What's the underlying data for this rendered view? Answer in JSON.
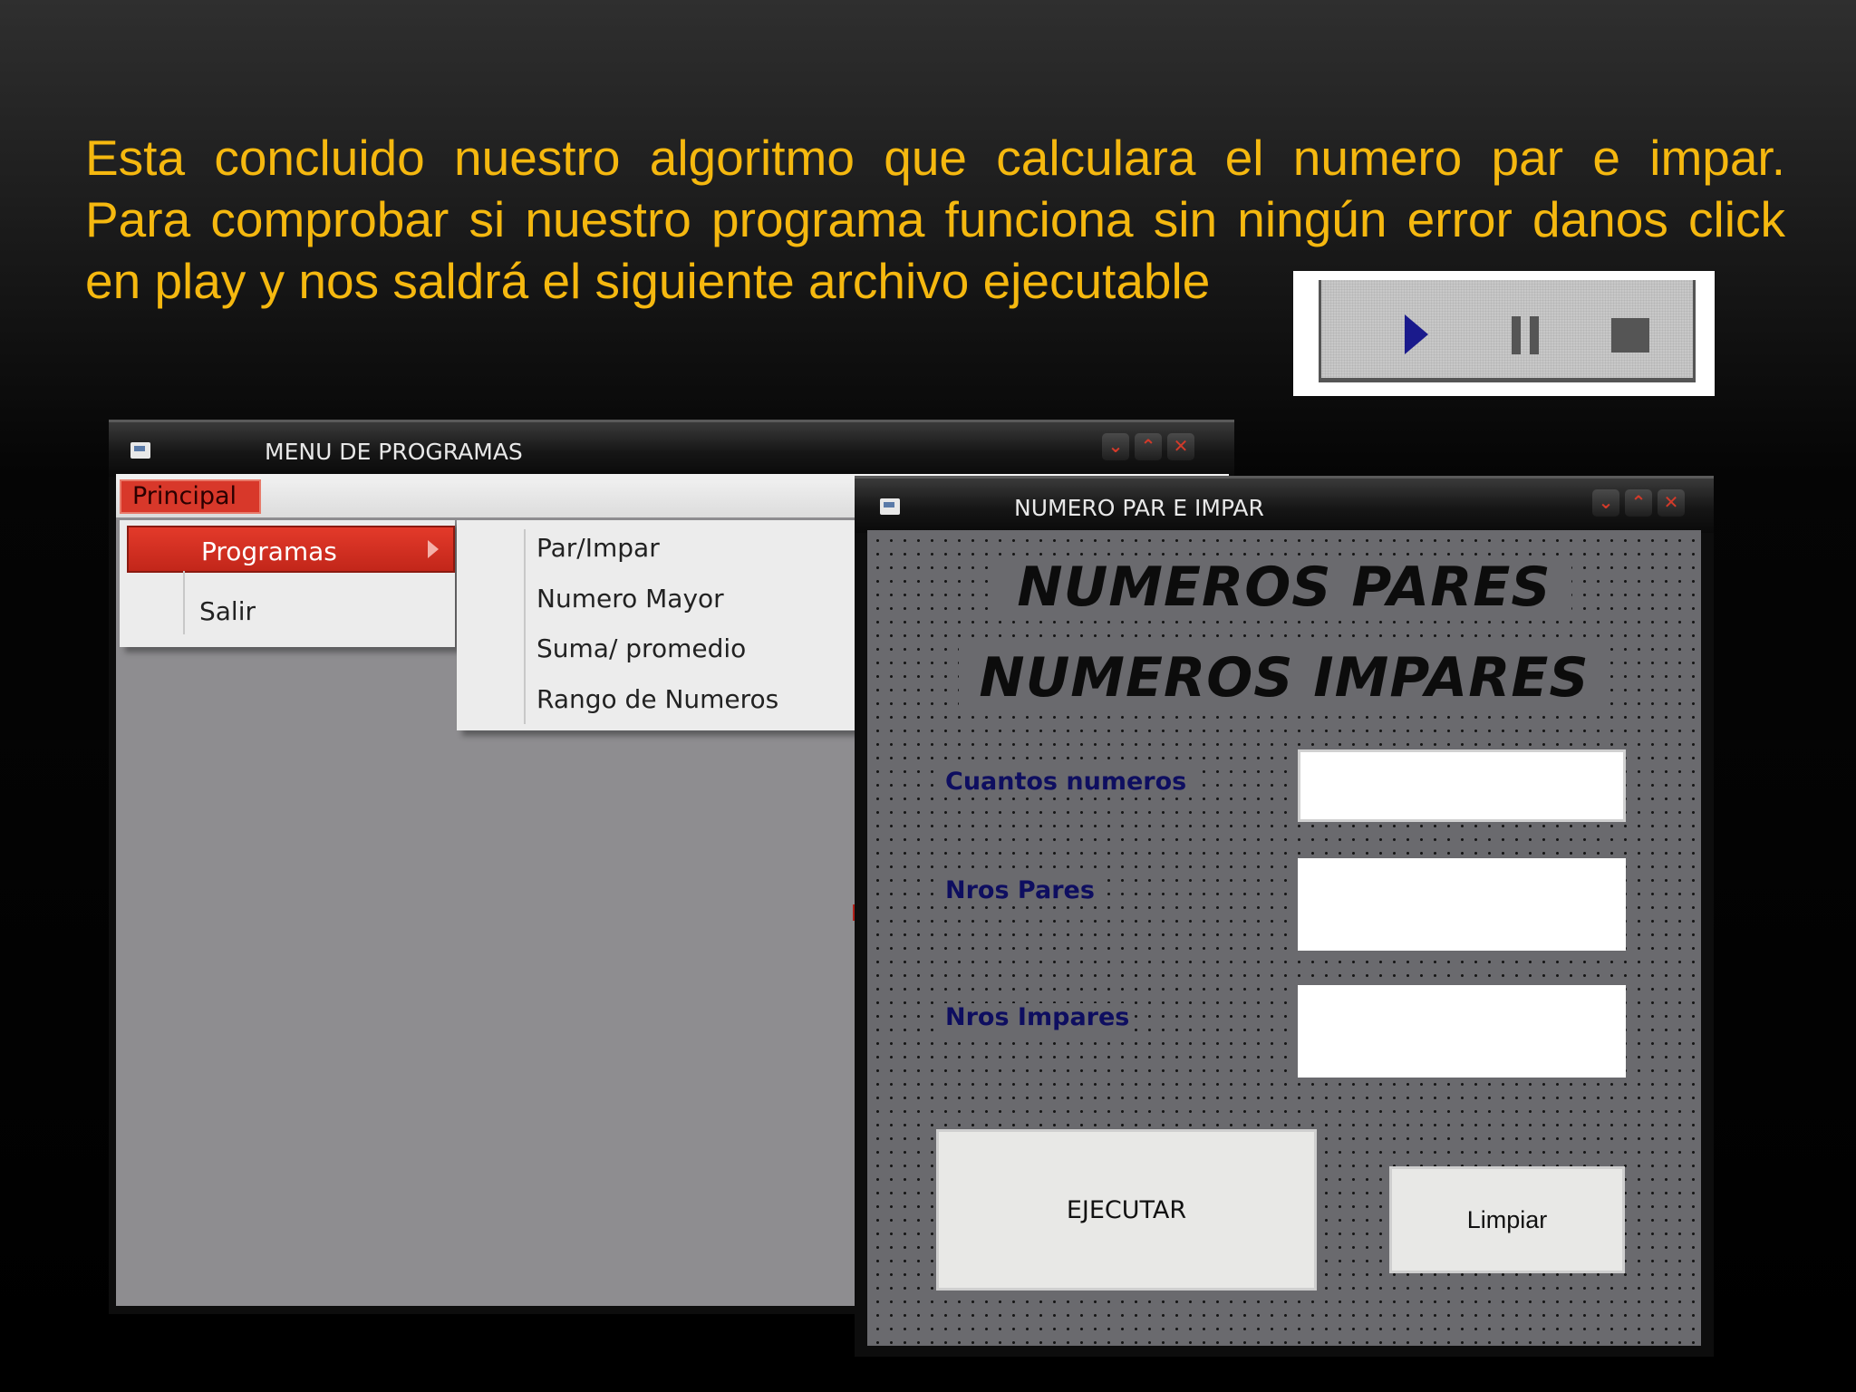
{
  "slide": {
    "line1": "Esta concluido nuestro algoritmo que calculara el numero par e impar.",
    "line2": "Para comprobar si nuestro programa funciona sin ningún error danos click",
    "line3": "en play y nos saldrá el siguiente archivo ejecutable",
    "text_color": "#f5b80f"
  },
  "player": {
    "buttons": [
      "play-icon",
      "pause-icon",
      "stop-icon"
    ],
    "play_color": "#1a1a8c"
  },
  "menu_window": {
    "title": "MENU DE PROGRAMAS",
    "controls": [
      "minimize",
      "restore",
      "close"
    ],
    "control_glyphs": [
      "⌄",
      "⌃",
      "✕"
    ],
    "menubar": {
      "principal": "Principal"
    },
    "dropdown": {
      "items": [
        "Programas",
        "Salir"
      ]
    },
    "submenu": {
      "items": [
        "Par/Impar",
        "Numero Mayor",
        "Suma/ promedio",
        "Rango de Numeros"
      ]
    },
    "accent": "#d8382a"
  },
  "form_window": {
    "title": "NUMERO PAR E IMPAR",
    "heading1": "NUMEROS PARES",
    "heading2": "NUMEROS IMPARES",
    "labels": {
      "count": "Cuantos numeros",
      "evens": "Nros Pares",
      "odds": "Nros Impares"
    },
    "values": {
      "count": "",
      "evens": "",
      "odds": ""
    },
    "buttons": {
      "run": "EJECUTAR",
      "clear": "Limpiar"
    },
    "label_color": "#0e0e60"
  }
}
